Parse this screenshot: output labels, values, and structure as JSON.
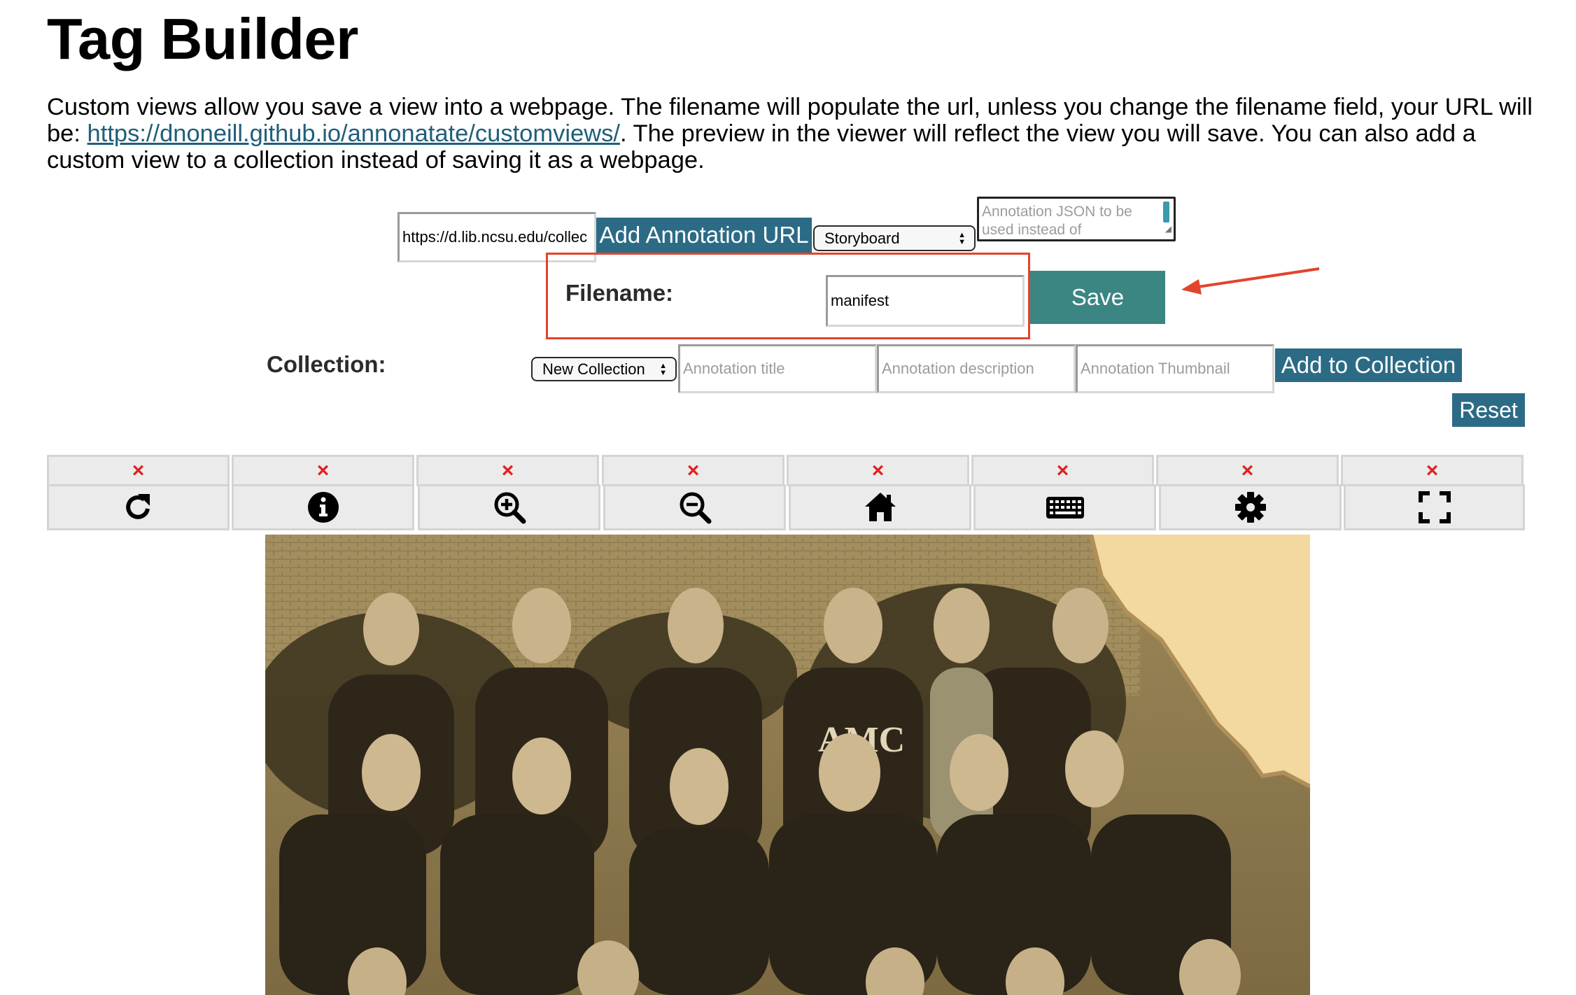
{
  "page": {
    "title": "Tag Builder",
    "intro_before_link": "Custom views allow you save a view into a webpage. The filename will populate the url, unless you change the filename field, your URL will be: ",
    "intro_link": "https://dnoneill.github.io/annonatate/customviews/",
    "intro_after_link": ". The preview in the viewer will reflect the view you will save. You can also add a custom view to a collection instead of saving it as a webpage."
  },
  "annotation": {
    "url_value": "https://d.lib.ncsu.edu/collec",
    "add_button": "Add Annotation URL",
    "layout_selected": "Storyboard",
    "json_placeholder": "Annotation JSON to be used instead of annotation"
  },
  "filename": {
    "label": "Filename:",
    "value": "manifest",
    "save_button": "Save"
  },
  "collection": {
    "label": "Collection:",
    "selected": "New Collection",
    "title_placeholder": "Annotation title",
    "description_placeholder": "Annotation description",
    "thumbnail_placeholder": "Annotation Thumbnail",
    "add_button": "Add to Collection",
    "reset_button": "Reset"
  },
  "toolbar": {
    "remove_mark": "×",
    "tools": [
      {
        "name": "rotate",
        "icon": "rotate-icon"
      },
      {
        "name": "info",
        "icon": "info-icon"
      },
      {
        "name": "zoom-in",
        "icon": "zoom-in-icon"
      },
      {
        "name": "zoom-out",
        "icon": "zoom-out-icon"
      },
      {
        "name": "home",
        "icon": "home-icon"
      },
      {
        "name": "keyboard",
        "icon": "keyboard-icon"
      },
      {
        "name": "settings",
        "icon": "gear-icon"
      },
      {
        "name": "fullscreen",
        "icon": "fullscreen-icon"
      }
    ]
  },
  "photo": {
    "jersey_text": "AMC"
  },
  "colors": {
    "accent_blue": "#2c6b86",
    "save_teal": "#3b8583",
    "highlight_red": "#e2442c",
    "remove_red": "#e2201f"
  }
}
